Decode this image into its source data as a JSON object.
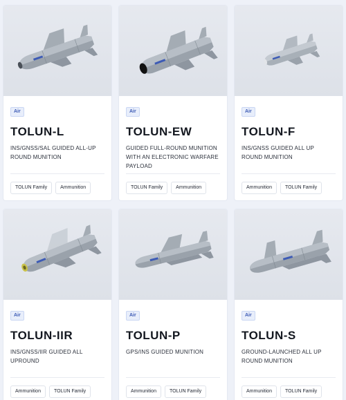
{
  "products": [
    {
      "category": "Air",
      "name": "TOLUN-L",
      "description": "INS/GNSS/SAL GUIDED ALL-UP ROUND MUNITION",
      "tags": [
        "TOLUN Family",
        "Ammunition"
      ],
      "image": "missile-image"
    },
    {
      "category": "Air",
      "name": "TOLUN-EW",
      "description": "GUIDED FULL-ROUND MUNITION WITH AN ELECTRONIC WARFARE PAYLOAD",
      "tags": [
        "TOLUN Family",
        "Ammunition"
      ],
      "image": "missile-image"
    },
    {
      "category": "Air",
      "name": "TOLUN-F",
      "description": "INS/GNSS GUIDED ALL UP ROUND MUNITION",
      "tags": [
        "Ammunition",
        "TOLUN Family"
      ],
      "image": "missile-image"
    },
    {
      "category": "Air",
      "name": "TOLUN-IIR",
      "description": " INS/GNSS/IIR GUIDED ALL UPROUND",
      "tags": [
        "Ammunition",
        "TOLUN Family"
      ],
      "image": "missile-image"
    },
    {
      "category": "Air",
      "name": "TOLUN-P",
      "description": "GPS/INS GUIDED MUNITION",
      "tags": [
        "Ammunition",
        "TOLUN Family"
      ],
      "image": "missile-image"
    },
    {
      "category": "Air",
      "name": "TOLUN-S",
      "description": "GROUND-LAUNCHED ALL UP ROUND MUNITION",
      "tags": [
        "Ammunition",
        "TOLUN Family"
      ],
      "image": "missile-image"
    }
  ],
  "colors": {
    "page_background": "#eef1f8",
    "card_background": "#ffffff",
    "tag_text": "#3d5bb5",
    "missile_body": "#9aa2ab",
    "missile_nose_ew": "#111111",
    "missile_seeker_iir": "#c9c24a"
  }
}
